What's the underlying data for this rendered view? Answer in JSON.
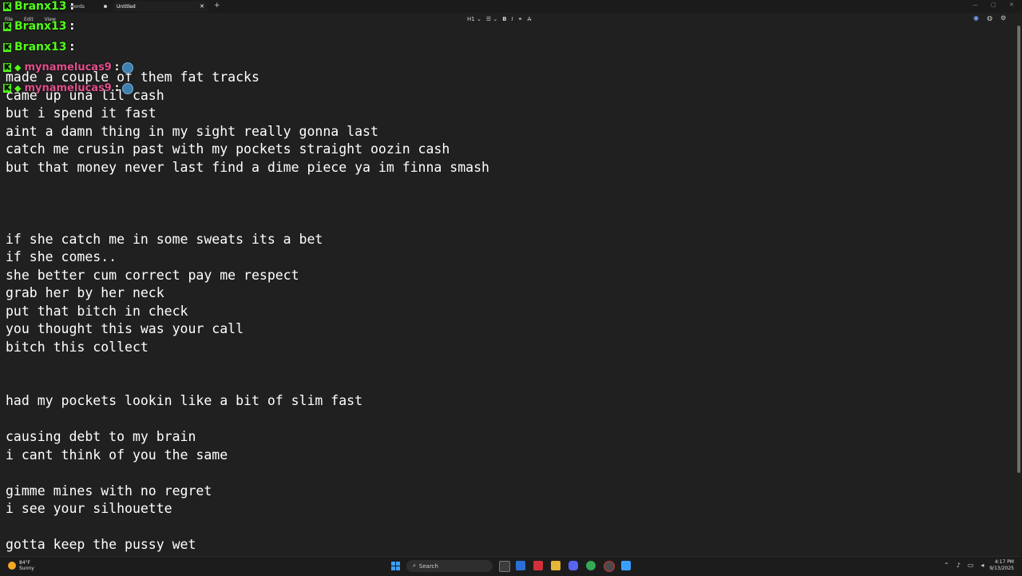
{
  "window": {
    "tabs": [
      {
        "label": "words",
        "state": "inactive"
      },
      {
        "label": "Untitled",
        "state": "active"
      }
    ],
    "new_tab": "+",
    "controls": [
      "—",
      "▢",
      "✕"
    ]
  },
  "menu": [
    "File",
    "Edit",
    "View"
  ],
  "toolbar": {
    "heading": "H1",
    "list": "☰",
    "bold": "B",
    "italic": "I",
    "link": "⚭",
    "clear": "A̶"
  },
  "chat": [
    {
      "user": "Branx13",
      "colon": ":",
      "color": "#53fc18"
    },
    {
      "user": "Branx13",
      "colon": ":",
      "color": "#53fc18"
    },
    {
      "user": "mynamelucas9",
      "colon": ":",
      "color": "#e04f8a"
    },
    {
      "user": "mynamelucas9",
      "colon": ":",
      "color": "#e04f8a"
    }
  ],
  "document": {
    "lines": [
      "made a couple of them fat tracks",
      "came up una lil cash",
      "but i spend it fast",
      "aint a damn thing in my sight really gonna last",
      "catch me crusin past with my pockets straight oozin cash",
      "but that money never last find a dime piece ya im finna smash",
      "",
      "",
      "",
      "if she catch me in some sweats its a bet",
      "if she comes..",
      "she better cum correct pay me respect",
      "grab her by her neck",
      "put that bitch in check",
      "you thought this was your call",
      "bitch this collect",
      "",
      "",
      "had my pockets lookin like a bit of slim fast",
      "",
      "causing debt to my brain",
      "i cant think of you the same",
      "",
      "gimme mines with no regret",
      "i see your silhouette",
      "",
      "gotta keep the pussy wet"
    ]
  },
  "taskbar": {
    "weather_temp": "84°F",
    "weather_desc": "Sunny",
    "search_placeholder": "Search",
    "time": "4:17 PM",
    "date": "9/13/2025"
  },
  "colors": {
    "background": "#202020",
    "kick_green": "#53fc18",
    "chat_pink": "#e04f8a",
    "windows_blue": "#3aa0ff"
  }
}
